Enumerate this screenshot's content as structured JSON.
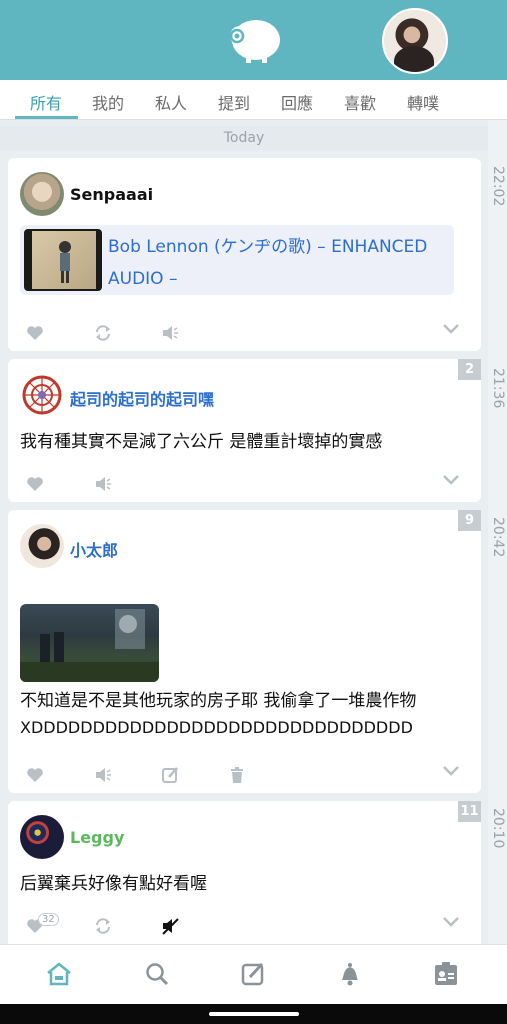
{
  "header": {
    "logo_icon": "sheep-logo-icon",
    "accent": "#5fb6c0"
  },
  "tabs": [
    {
      "label": "所有",
      "active": true
    },
    {
      "label": "我的"
    },
    {
      "label": "私人"
    },
    {
      "label": "提到"
    },
    {
      "label": "回應"
    },
    {
      "label": "喜歡"
    },
    {
      "label": "轉噗"
    }
  ],
  "today_label": "Today",
  "times": [
    "22:02",
    "21:36",
    "20:42",
    "20:10"
  ],
  "posts": [
    {
      "author": "Senpaaai",
      "name_color": "#111111",
      "music_title": "Bob Lennon (ケンヂの歌) – ENHANCED AUDIO –",
      "actions": [
        "heart-icon",
        "replurk-icon",
        "mute-icon"
      ]
    },
    {
      "author": "起司的起司的起司嘿",
      "name_color": "#2a6fcf",
      "badge": "2",
      "text": "我有種其實不是減了六公斤 是體重計壞掉的實感",
      "actions": [
        "heart-icon",
        "mute-icon"
      ]
    },
    {
      "author": "小太郎",
      "name_color": "#2a6fcf",
      "badge": "9",
      "text_line1": "不知道是不是其他玩家的房子耶 我偷拿了一堆農作物",
      "text_line2": "XDDDDDDDDDDDDDDDDDDDDDDDDDDDDDDD",
      "actions": [
        "heart-icon",
        "mute-icon",
        "edit-icon",
        "trash-icon"
      ]
    },
    {
      "author": "Leggy",
      "name_color": "#5cb85c",
      "badge": "11",
      "text": "后翼棄兵好像有點好看喔",
      "like_count": "32",
      "actions": [
        "heart-icon",
        "replurk-icon",
        "muted-icon"
      ]
    }
  ],
  "bottom_nav": [
    "home-icon",
    "search-icon",
    "compose-icon",
    "bell-icon",
    "profile-card-icon"
  ]
}
